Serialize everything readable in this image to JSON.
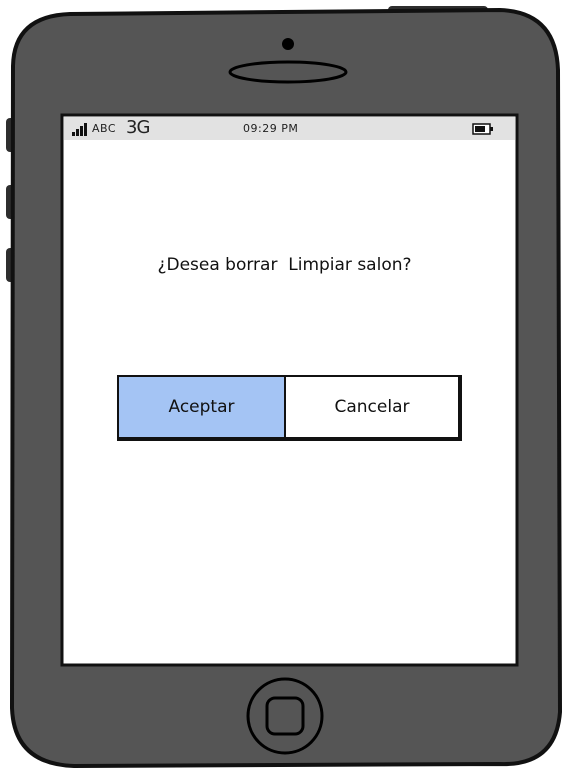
{
  "status_bar": {
    "carrier": "ABC",
    "network": "3G",
    "time": "09:29 PM"
  },
  "dialog": {
    "message": "¿Desea borrar  Limpiar salon?",
    "accept_label": "Aceptar",
    "cancel_label": "Cancelar"
  },
  "colors": {
    "phone_body": "#555555",
    "phone_outline": "#111111",
    "status_bar_bg": "#e2e2e2",
    "accept_button_bg": "#a4c4f4",
    "cancel_button_bg": "#ffffff"
  },
  "icons": {
    "signal": "signal-bars-icon",
    "battery": "battery-icon",
    "camera": "camera-icon",
    "speaker": "speaker-icon",
    "home": "home-button-icon"
  }
}
